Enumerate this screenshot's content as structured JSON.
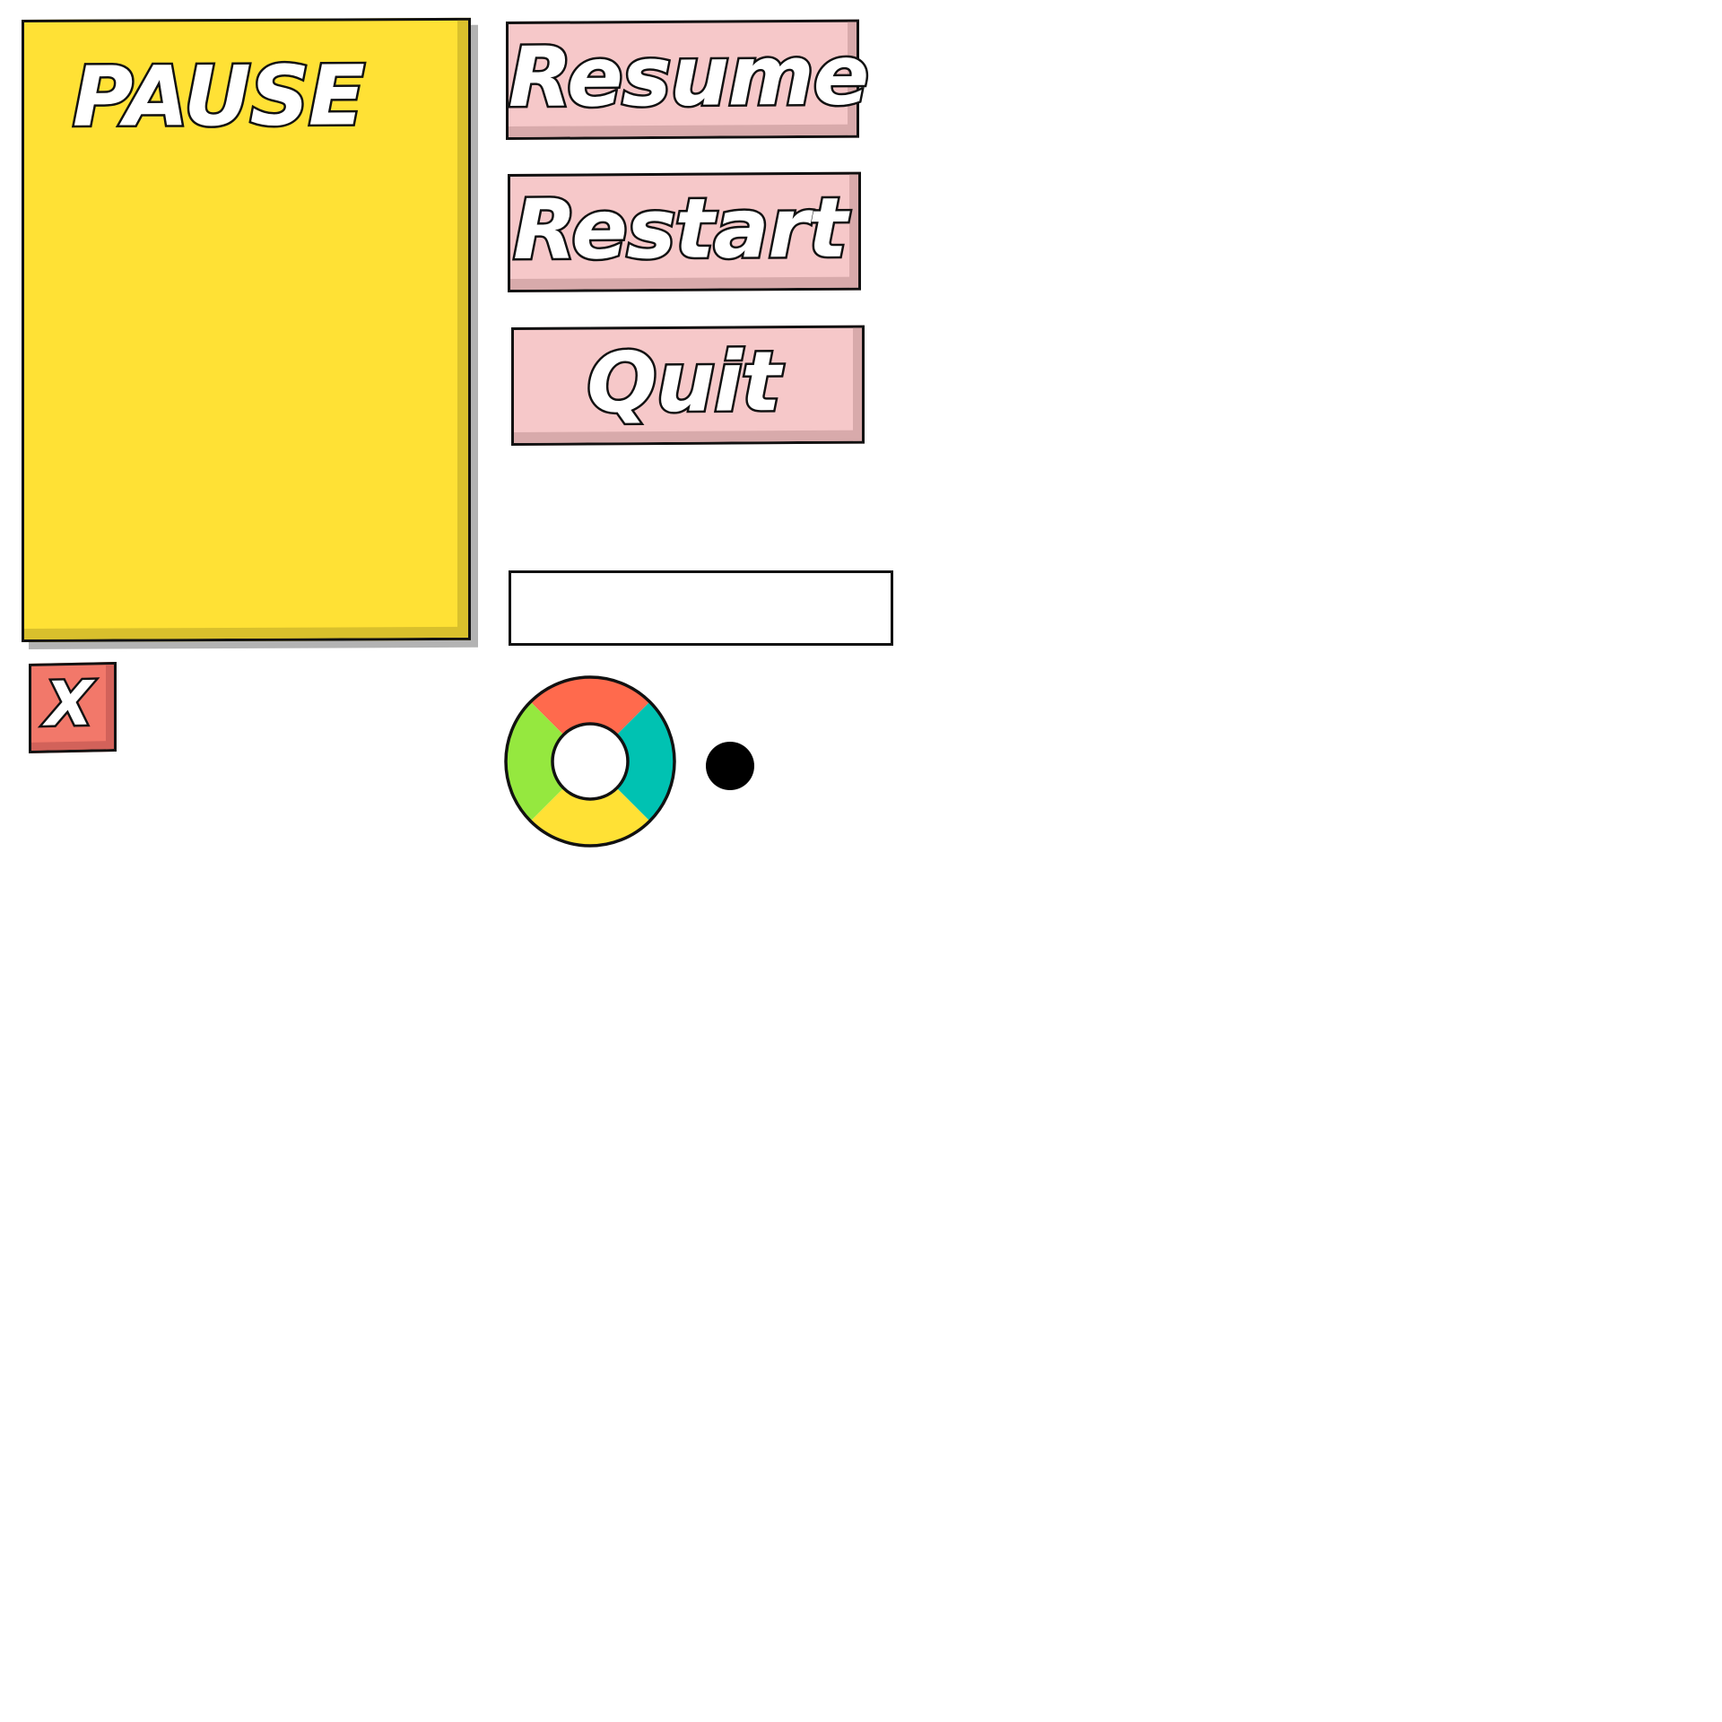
{
  "pause_panel": {
    "title": "PAUSE",
    "background_color": "#ffe135"
  },
  "menu": {
    "buttons": [
      {
        "label": "Resume"
      },
      {
        "label": "Restart"
      },
      {
        "label": "Quit"
      }
    ],
    "button_color": "#f6c8c9"
  },
  "close_button": {
    "label": "X",
    "color": "#f2786a"
  },
  "text_field": {
    "value": ""
  },
  "color_wheel": {
    "segments": [
      {
        "name": "top",
        "color": "#ff6a4d"
      },
      {
        "name": "right",
        "color": "#00c2b2"
      },
      {
        "name": "bottom",
        "color": "#ffe135"
      },
      {
        "name": "left",
        "color": "#95e83f"
      }
    ]
  },
  "indicator_dot": {
    "color": "#000000"
  }
}
